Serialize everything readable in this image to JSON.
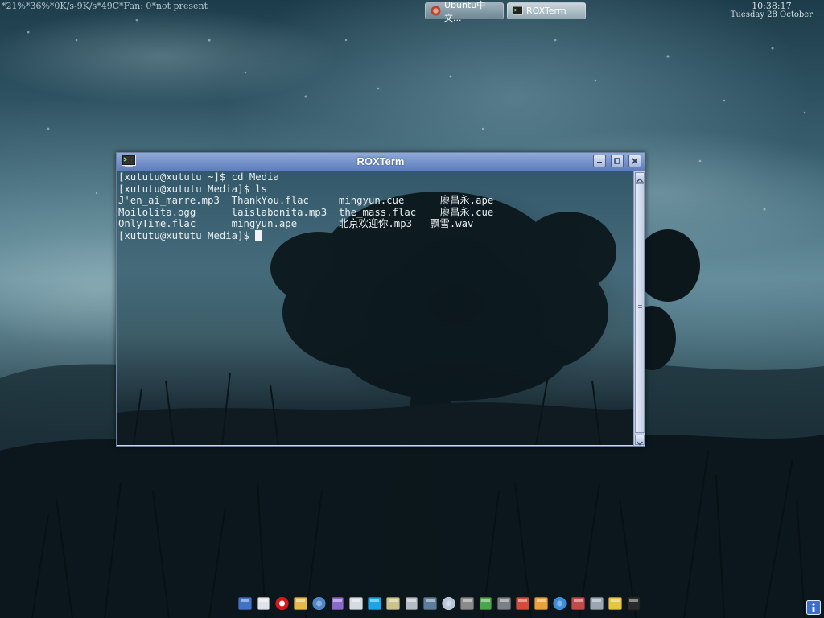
{
  "panel": {
    "sysmon_text": "*21%*36%*0K/s-9K/s*49C*Fan: 0*not present",
    "clock_time": "10:38:17",
    "clock_date": "Tuesday 28 October"
  },
  "taskbar": {
    "tasks": [
      {
        "label": "Ubuntu中文...",
        "icon": "browser-icon",
        "active": false
      },
      {
        "label": "ROXTerm",
        "icon": "terminal-icon",
        "active": true
      }
    ]
  },
  "window": {
    "title": "ROXTerm",
    "buttons": [
      "minimize-icon",
      "maximize-icon",
      "close-icon"
    ]
  },
  "terminal": {
    "lines": [
      "[xututu@xututu ~]$ cd Media",
      "[xututu@xututu Media]$ ls",
      "J'en_ai_marre.mp3  ThankYou.flac     mingyun.cue      廖昌永.ape",
      "Moilolita.ogg      laislabonita.mp3  the_mass.flac    廖昌永.cue",
      "OnlyTime.flac      mingyun.ape       北京欢迎你.mp3   飘雪.wav",
      "[xututu@xututu Media]$ "
    ]
  },
  "dock": {
    "icons": [
      {
        "name": "folder-icon",
        "color": "#3f73c6"
      },
      {
        "name": "text-editor-icon",
        "color": "#e0e4ea"
      },
      {
        "name": "opera-icon",
        "color": "#d21a1a"
      },
      {
        "name": "document-icon",
        "color": "#e6b84a"
      },
      {
        "name": "chat-icon",
        "color": "#4f86c6"
      },
      {
        "name": "messenger-icon",
        "color": "#8a6ac8"
      },
      {
        "name": "notes-icon",
        "color": "#d6dbe3"
      },
      {
        "name": "skype-icon",
        "color": "#1aa6e6"
      },
      {
        "name": "image-viewer-icon",
        "color": "#c9c38f"
      },
      {
        "name": "pdf-icon",
        "color": "#b6bcc7"
      },
      {
        "name": "network-icon",
        "color": "#5e7c9e"
      },
      {
        "name": "disc-icon",
        "color": "#b9c7d9"
      },
      {
        "name": "calculator-icon",
        "color": "#8a8a8a"
      },
      {
        "name": "spreadsheet-icon",
        "color": "#4aa64a"
      },
      {
        "name": "mixer-icon",
        "color": "#7b7f86"
      },
      {
        "name": "media-player-icon",
        "color": "#d44b3a"
      },
      {
        "name": "paint-icon",
        "color": "#e9a23a"
      },
      {
        "name": "globe-icon",
        "color": "#3c8ed9"
      },
      {
        "name": "dictionary-icon",
        "color": "#c24a4a"
      },
      {
        "name": "settings-icon",
        "color": "#9aa4b2"
      },
      {
        "name": "chart-icon",
        "color": "#e3c742"
      },
      {
        "name": "terminal-icon",
        "color": "#2b2b2b"
      }
    ]
  },
  "tray": {
    "icon": "info-icon",
    "color": "#3d6fc9"
  }
}
